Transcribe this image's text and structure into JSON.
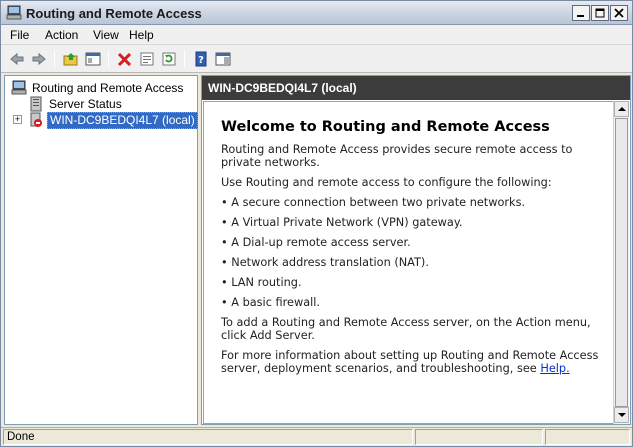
{
  "window": {
    "title": "Routing and Remote Access",
    "minimize_label": "_",
    "maximize_label": "□",
    "close_label": "X"
  },
  "menu": [
    {
      "label": "File"
    },
    {
      "label": "Action"
    },
    {
      "label": "View"
    },
    {
      "label": "Help"
    }
  ],
  "tree": {
    "root": "Routing and Remote Access",
    "items": [
      {
        "label": "Server Status"
      },
      {
        "label": "WIN-DC9BEDQI4L7 (local)",
        "selected": true,
        "expander": "+"
      }
    ]
  },
  "right": {
    "header": "WIN-DC9BEDQI4L7 (local)"
  },
  "welcome": {
    "title": "Welcome to Routing and Remote Access",
    "intro": "Routing and Remote Access provides secure remote access to private networks.",
    "use_line": "Use Routing and remote access to configure the following:",
    "bullets": [
      "• A secure connection between two private networks.",
      "• A Virtual Private Network (VPN) gateway.",
      "• A Dial-up remote access server.",
      "• Network address translation (NAT).",
      "• LAN routing.",
      "• A basic firewall."
    ],
    "add_server": "To add a Routing and Remote Access server, on the Action menu, click Add Server.",
    "more_info": "For more information about setting up Routing and Remote Access server, deployment scenarios, and troubleshooting, see ",
    "help_link": "Help."
  },
  "status": {
    "text": "Done"
  },
  "colors": {
    "header_bg": "#3c3c3c",
    "selection": "#316ac5",
    "link": "#0033cc"
  }
}
